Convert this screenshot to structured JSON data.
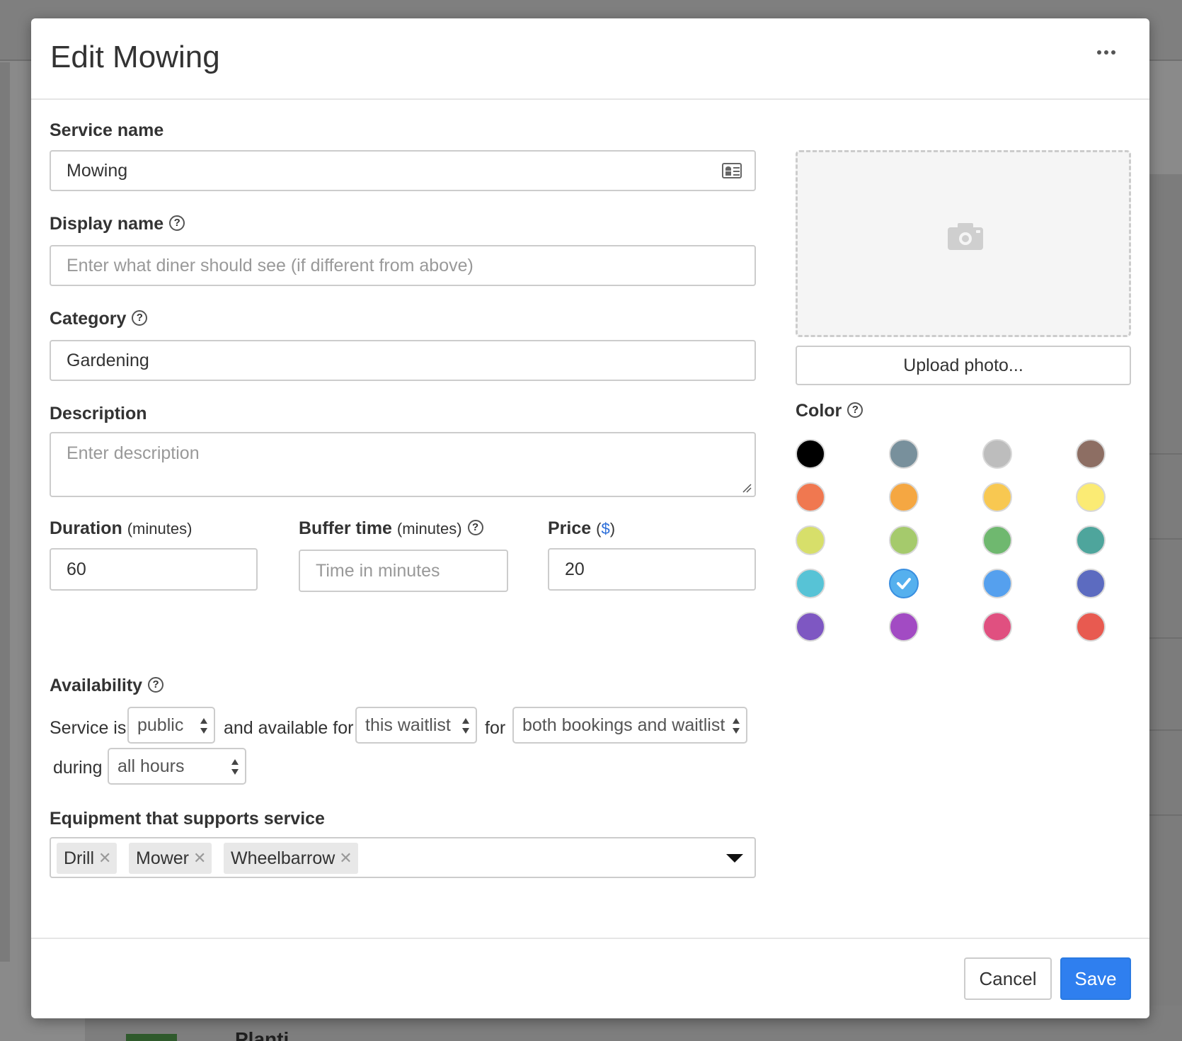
{
  "modal": {
    "title": "Edit Mowing",
    "more_icon": "ellipsis-icon"
  },
  "form": {
    "service_name": {
      "label": "Service name",
      "value": "Mowing",
      "icon": "contact-card-icon"
    },
    "display_name": {
      "label": "Display name",
      "help": "?",
      "placeholder": "Enter what diner should see (if different from above)"
    },
    "category": {
      "label": "Category",
      "help": "?",
      "value": "Gardening"
    },
    "description": {
      "label": "Description",
      "placeholder": "Enter description"
    },
    "duration": {
      "label": "Duration",
      "unit": "(minutes)",
      "value": "60"
    },
    "buffer_time": {
      "label": "Buffer time",
      "unit": "(minutes)",
      "help": "?",
      "placeholder": "Time in minutes"
    },
    "price": {
      "label": "Price",
      "unit_open": "(",
      "unit_symbol": "$",
      "unit_close": ")",
      "value": "20"
    }
  },
  "photo": {
    "icon": "camera-icon",
    "upload_label": "Upload photo..."
  },
  "color": {
    "label": "Color",
    "help": "?",
    "swatches": [
      "#000000",
      "#78909c",
      "#bdbdbd",
      "#8d6e63",
      "#f07850",
      "#f5a742",
      "#f8c851",
      "#fbeb74",
      "#d7df6a",
      "#a5ca6c",
      "#6fb86f",
      "#4ea59c",
      "#57c3d6",
      "#55b0ee",
      "#55a0ee",
      "#5c6bc0",
      "#7e57c2",
      "#a24bc3",
      "#e05080",
      "#e85a50"
    ],
    "selected_index": 13
  },
  "availability": {
    "label": "Availability",
    "help": "?",
    "text_service_is": "Service is",
    "visibility": "public",
    "text_available_for": "and available for",
    "scope": "this waitlist",
    "text_for": "for",
    "mode": "both bookings and waitlist",
    "text_during": "during",
    "hours": "all hours"
  },
  "equipment": {
    "label": "Equipment that supports service",
    "tags": [
      "Drill",
      "Mower",
      "Wheelbarrow"
    ],
    "remove_glyph": "✕"
  },
  "footer": {
    "cancel_label": "Cancel",
    "save_label": "Save"
  },
  "background": {
    "partial_text": "Planti"
  }
}
